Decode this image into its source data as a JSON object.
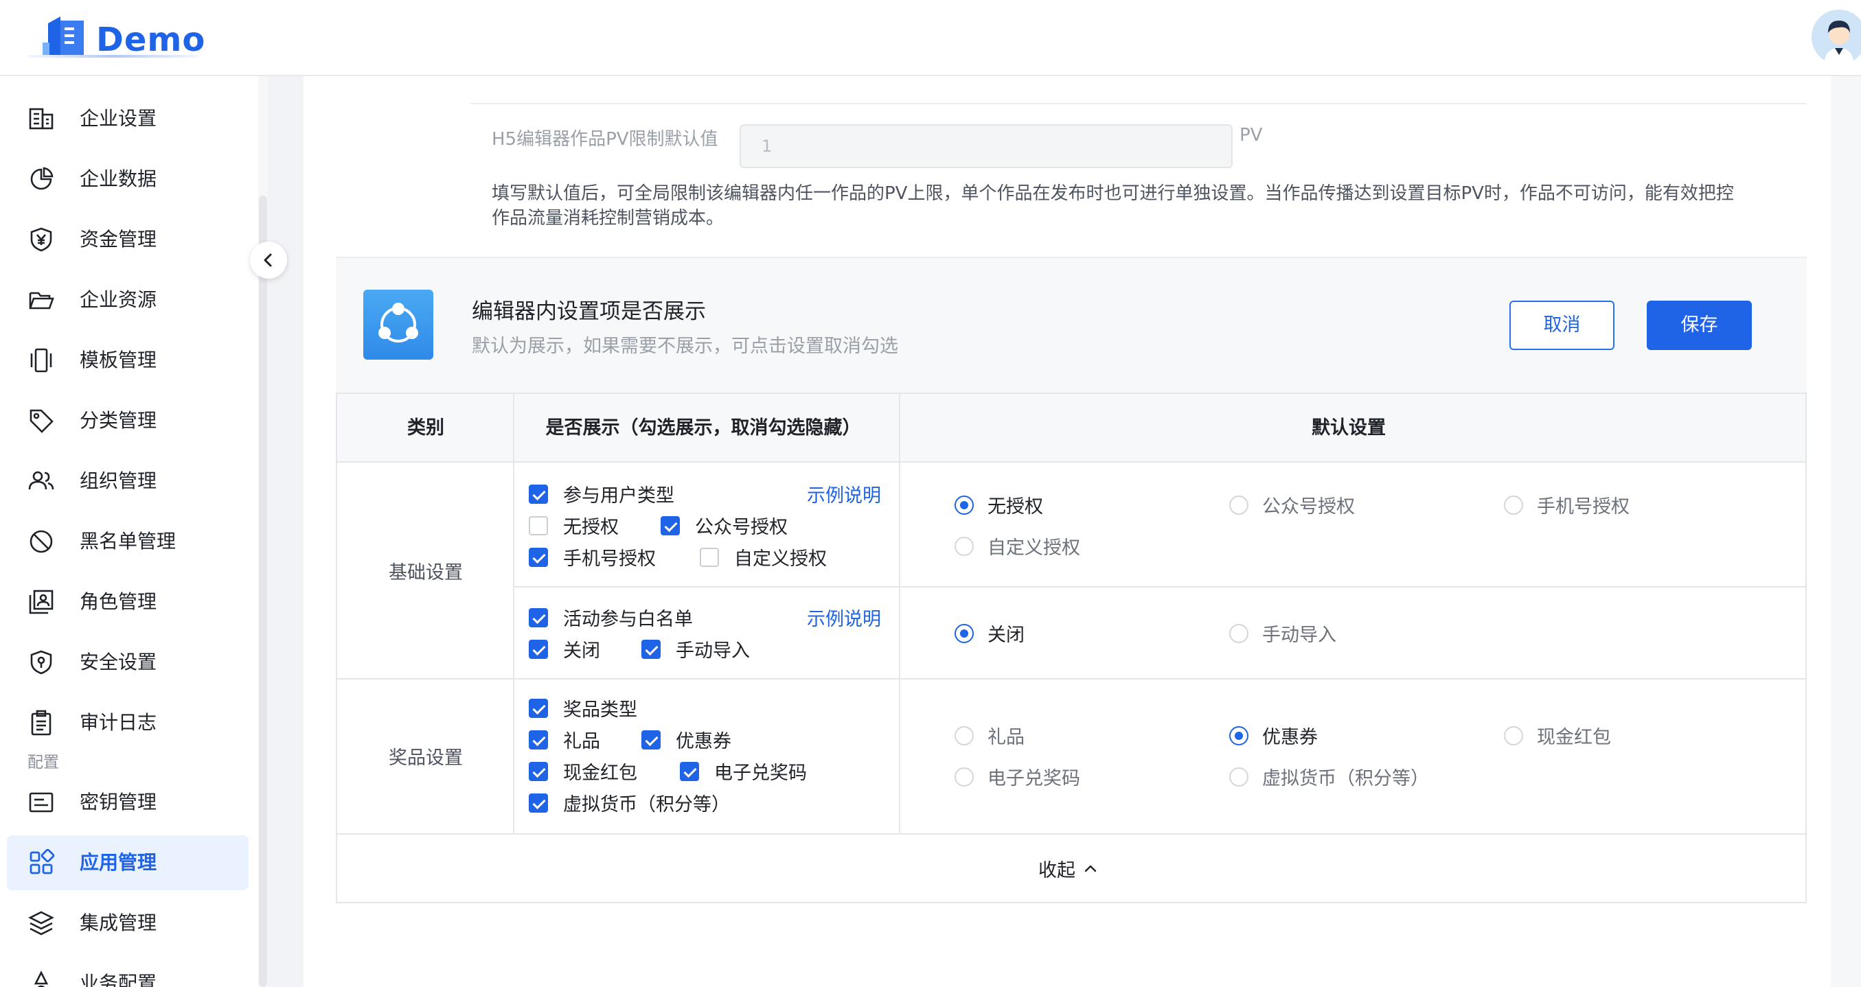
{
  "app": {
    "logo_text": "Demo"
  },
  "sidebar": {
    "items": [
      {
        "label": "企业设置",
        "icon": "building-icon"
      },
      {
        "label": "企业数据",
        "icon": "pie-chart-icon"
      },
      {
        "label": "资金管理",
        "icon": "yen-shield-icon"
      },
      {
        "label": "企业资源",
        "icon": "folder-open-icon"
      },
      {
        "label": "模板管理",
        "icon": "template-icon"
      },
      {
        "label": "分类管理",
        "icon": "tag-icon"
      },
      {
        "label": "组织管理",
        "icon": "users-icon"
      },
      {
        "label": "黑名单管理",
        "icon": "ban-icon"
      },
      {
        "label": "角色管理",
        "icon": "role-card-icon"
      },
      {
        "label": "安全设置",
        "icon": "security-shield-icon"
      },
      {
        "label": "审计日志",
        "icon": "clipboard-icon"
      }
    ],
    "group_label": "配置",
    "config_items": [
      {
        "label": "密钥管理",
        "icon": "key-card-icon"
      },
      {
        "label": "应用管理",
        "icon": "apps-grid-icon",
        "active": true
      },
      {
        "label": "集成管理",
        "icon": "layers-icon"
      },
      {
        "label": "业务配置",
        "icon": "business-icon"
      }
    ]
  },
  "pv_setting": {
    "label": "H5编辑器作品PV限制默认值",
    "value": "1",
    "unit": "PV",
    "description": "填写默认值后，可全局限制该编辑器内任一作品的PV上限，单个作品在发布时也可进行单独设置。当作品传播达到设置目标PV时，作品不可访问，能有效把控作品流量消耗控制营销成本。"
  },
  "display_section": {
    "title": "编辑器内设置项是否展示",
    "subtitle": "默认为展示，如果需要不展示，可点击设置取消勾选",
    "cancel_label": "取消",
    "save_label": "保存"
  },
  "table": {
    "headers": [
      "类别",
      "是否展示（勾选展示，取消勾选隐藏）",
      "默认设置"
    ],
    "groups": [
      {
        "category": "基础设置",
        "rows": [
          {
            "example_link": "示例说明",
            "checkboxes": [
              [
                {
                  "label": "参与用户类型",
                  "checked": true
                }
              ],
              [
                {
                  "label": "无授权",
                  "checked": false
                },
                {
                  "label": "公众号授权",
                  "checked": true
                }
              ],
              [
                {
                  "label": "手机号授权",
                  "checked": true
                },
                {
                  "label": "自定义授权",
                  "checked": false
                }
              ]
            ],
            "radios": [
              {
                "label": "无授权",
                "selected": true
              },
              {
                "label": "公众号授权",
                "selected": false
              },
              {
                "label": "手机号授权",
                "selected": false
              },
              {
                "label": "自定义授权",
                "selected": false
              }
            ]
          },
          {
            "example_link": "示例说明",
            "checkboxes": [
              [
                {
                  "label": "活动参与白名单",
                  "checked": true
                }
              ],
              [
                {
                  "label": "关闭",
                  "checked": true
                },
                {
                  "label": "手动导入",
                  "checked": true
                }
              ]
            ],
            "radios": [
              {
                "label": "关闭",
                "selected": true
              },
              {
                "label": "手动导入",
                "selected": false
              }
            ]
          }
        ]
      },
      {
        "category": "奖品设置",
        "rows": [
          {
            "checkboxes": [
              [
                {
                  "label": "奖品类型",
                  "checked": true
                }
              ],
              [
                {
                  "label": "礼品",
                  "checked": true
                },
                {
                  "label": "优惠券",
                  "checked": true
                }
              ],
              [
                {
                  "label": "现金红包",
                  "checked": true
                },
                {
                  "label": "电子兑奖码",
                  "checked": true
                }
              ],
              [
                {
                  "label": "虚拟货币（积分等）",
                  "checked": true
                }
              ]
            ],
            "radios": [
              {
                "label": "礼品",
                "selected": false
              },
              {
                "label": "优惠券",
                "selected": true
              },
              {
                "label": "现金红包",
                "selected": false
              },
              {
                "label": "电子兑奖码",
                "selected": false
              },
              {
                "label": "虚拟货币（积分等）",
                "selected": false
              }
            ]
          }
        ]
      }
    ],
    "collapse_label": "收起"
  },
  "colors": {
    "accent": "#1f63e6",
    "active_bg": "#eaf1ff"
  }
}
